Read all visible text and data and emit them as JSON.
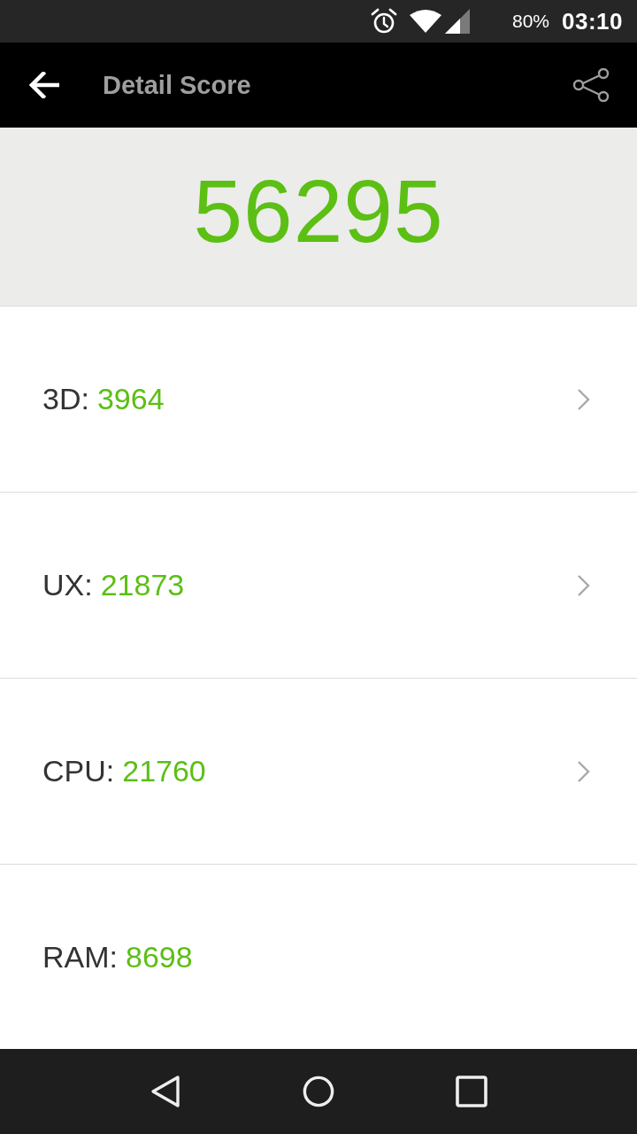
{
  "status_bar": {
    "battery": "80%",
    "time": "03:10"
  },
  "app_bar": {
    "title": "Detail Score"
  },
  "total_score": "56295",
  "scores": [
    {
      "label": "3D:",
      "value": "3964",
      "has_details": true
    },
    {
      "label": "UX:",
      "value": "21873",
      "has_details": true
    },
    {
      "label": "CPU:",
      "value": "21760",
      "has_details": true
    },
    {
      "label": "RAM:",
      "value": "8698",
      "has_details": false
    }
  ]
}
